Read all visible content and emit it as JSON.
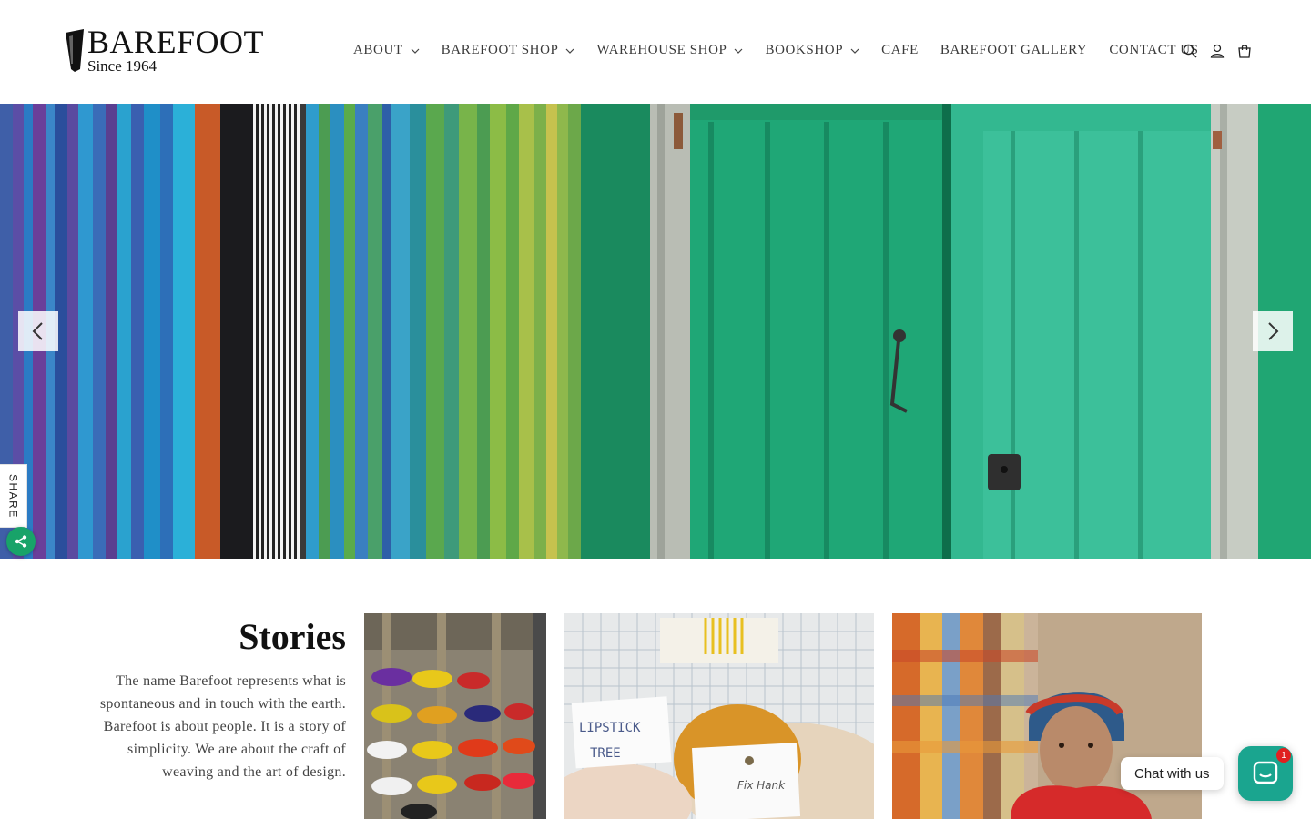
{
  "brand": {
    "name": "BAREFOOT",
    "tagline": "Since 1964"
  },
  "nav": {
    "items": [
      {
        "label": "ABOUT",
        "has_dropdown": true
      },
      {
        "label": "BAREFOOT SHOP",
        "has_dropdown": true
      },
      {
        "label": "WAREHOUSE SHOP",
        "has_dropdown": true
      },
      {
        "label": "BOOKSHOP",
        "has_dropdown": true
      },
      {
        "label": "CAFE",
        "has_dropdown": false
      },
      {
        "label": "BAREFOOT GALLERY",
        "has_dropdown": false
      },
      {
        "label": "CONTACT US",
        "has_dropdown": false
      }
    ]
  },
  "header_icons": [
    "search-icon",
    "account-icon",
    "cart-icon"
  ],
  "hero": {
    "prev_icon": "chevron-left-icon",
    "next_icon": "chevron-right-icon"
  },
  "share": {
    "label": "SHARE",
    "icon": "share-icon",
    "color": "#18a369"
  },
  "stories": {
    "title": "Stories",
    "text": "The name Barefoot represents what is spontaneous and in touch with the earth. Barefoot is about people. It is a story of simplicity. We are about the craft of weaving and the art of design.",
    "card2_tag_1": "LIPSTICK",
    "card2_tag_2": "TREE",
    "card2_tag_3": "Fix Hank"
  },
  "chat": {
    "label": "Chat with us",
    "badge": "1",
    "color": "#1aa58f"
  }
}
